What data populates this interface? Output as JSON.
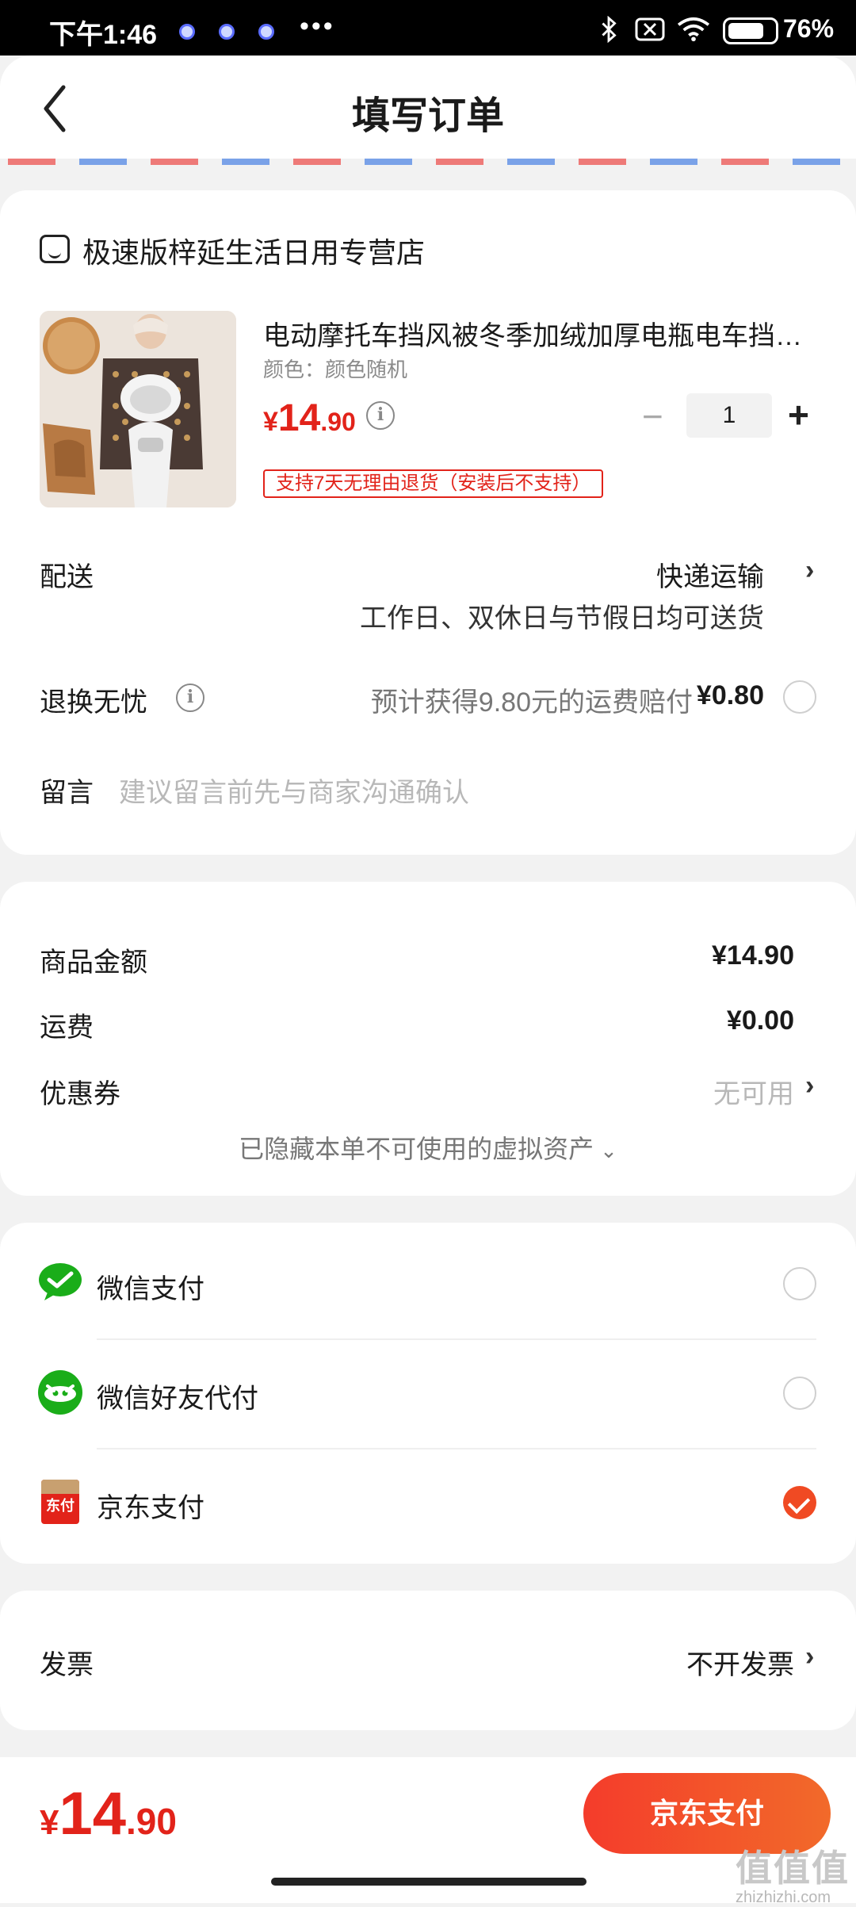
{
  "status_bar": {
    "time": "下午1:46",
    "more": "•••",
    "battery": "76%"
  },
  "header": {
    "title": "填写订单"
  },
  "store": {
    "name": "极速版梓延生活日用专营店"
  },
  "product": {
    "title": "电动摩托车挡风被冬季加绒加厚电瓶电车挡风被防水防寒保暖",
    "variant": "颜色：颜色随机",
    "price_currency": "¥",
    "price_int": "14",
    "price_dec": ".90",
    "quantity": "1",
    "minus": "−",
    "plus": "+",
    "return_policy": "支持7天无理由退货（安装后不支持）"
  },
  "delivery": {
    "label": "配送",
    "method": "快递运输",
    "note": "工作日、双休日与节假日均可送货"
  },
  "return_worry_free": {
    "label": "退换无忧",
    "desc": "预计获得9.80元的运费赔付",
    "price": "¥0.80"
  },
  "message": {
    "label": "留言",
    "placeholder": "建议留言前先与商家沟通确认"
  },
  "summary": {
    "goods_label": "商品金额",
    "goods_value": "¥14.90",
    "shipping_label": "运费",
    "shipping_value": "¥0.00",
    "coupon_label": "优惠券",
    "coupon_value": "无可用",
    "hidden_assets": "已隐藏本单不可使用的虚拟资产"
  },
  "payment_methods": [
    {
      "label": "微信支付",
      "selected": false
    },
    {
      "label": "微信好友代付",
      "selected": false
    },
    {
      "label": "京东支付",
      "selected": true
    }
  ],
  "jd_pay_icon_text": "东付",
  "invoice": {
    "label": "发票",
    "value": "不开发票"
  },
  "footer": {
    "total_currency": "¥",
    "total_int": "14",
    "total_dec": ".90",
    "pay_button": "京东支付"
  },
  "watermark": {
    "main": "值值值",
    "sub": "zhizhizhi.com"
  },
  "colors": {
    "accent_red": "#e2231a",
    "pay_orange": "#f04a23",
    "wechat_green": "#1aad19"
  }
}
